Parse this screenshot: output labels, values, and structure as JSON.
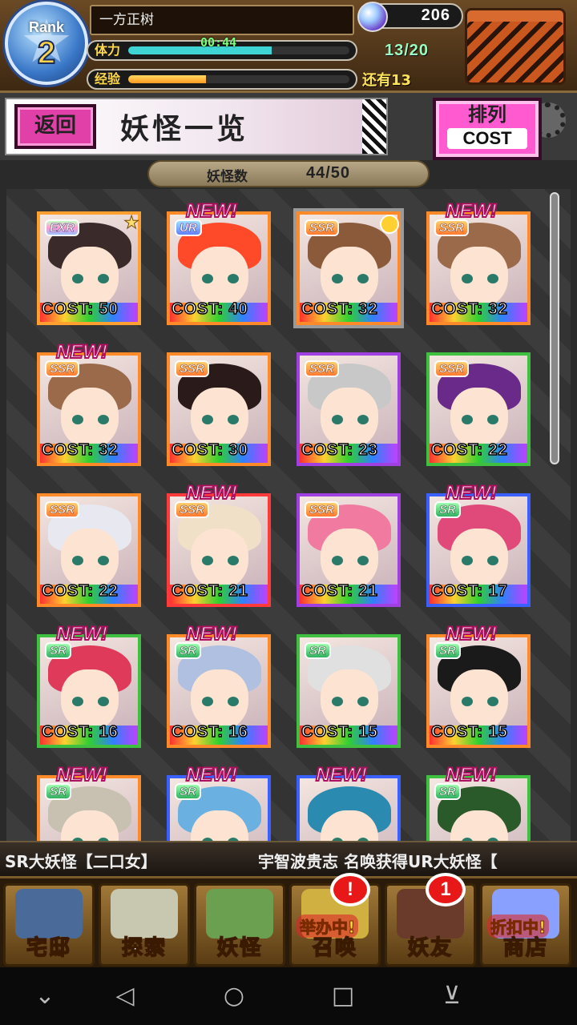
{
  "header": {
    "rank_label": "Rank",
    "rank_value": "2",
    "player_name": "一方正树",
    "stamina_label": "体力",
    "stamina_timer": "00:44",
    "stamina_count": "13/20",
    "stamina_fraction": 0.65,
    "exp_label": "经验",
    "exp_remaining": "还有13",
    "exp_fraction": 0.35,
    "gems": "206"
  },
  "title_bar": {
    "back_label": "返回",
    "page_title": "妖怪一览",
    "sort_line1": "排列",
    "sort_line2": "COST"
  },
  "count": {
    "label": "妖怪数",
    "value": "44/50"
  },
  "cards": [
    {
      "rarity": "EXR",
      "cost": "COST: 50",
      "new": false,
      "crown": false,
      "star": true,
      "border": "#ffa030",
      "hair": "#3a2a2a"
    },
    {
      "rarity": "UR",
      "cost": "COST: 40",
      "new": true,
      "crown": false,
      "star": false,
      "border": "#ff8a2a",
      "hair": "#ff4a2a"
    },
    {
      "rarity": "SSR",
      "cost": "COST: 32",
      "new": false,
      "crown": true,
      "star": false,
      "border": "#ff8a2a",
      "hair": "#8a5a3a"
    },
    {
      "rarity": "SSR",
      "cost": "COST: 32",
      "new": true,
      "crown": false,
      "star": false,
      "border": "#ff8a2a",
      "hair": "#9a6a4a"
    },
    {
      "rarity": "SSR",
      "cost": "COST: 32",
      "new": true,
      "crown": false,
      "star": false,
      "border": "#ff8a2a",
      "hair": "#9a6a4a"
    },
    {
      "rarity": "SSR",
      "cost": "COST: 30",
      "new": false,
      "crown": false,
      "star": false,
      "border": "#ff8a2a",
      "hair": "#2a1a1a"
    },
    {
      "rarity": "SSR",
      "cost": "COST: 23",
      "new": false,
      "crown": false,
      "star": false,
      "border": "#a040e0",
      "hair": "#c8c8c8"
    },
    {
      "rarity": "SSR",
      "cost": "COST: 22",
      "new": false,
      "crown": false,
      "star": false,
      "border": "#40c040",
      "hair": "#6a2a8a"
    },
    {
      "rarity": "SSR",
      "cost": "COST: 22",
      "new": false,
      "crown": false,
      "star": false,
      "border": "#ff8a2a",
      "hair": "#e8e8f0"
    },
    {
      "rarity": "SSR",
      "cost": "COST: 21",
      "new": true,
      "crown": false,
      "star": false,
      "border": "#ff3a3a",
      "hair": "#f0e0c8"
    },
    {
      "rarity": "SSR",
      "cost": "COST: 21",
      "new": false,
      "crown": false,
      "star": false,
      "border": "#a040e0",
      "hair": "#f07aa0"
    },
    {
      "rarity": "SR",
      "cost": "COST: 17",
      "new": true,
      "crown": false,
      "star": false,
      "border": "#3a60ff",
      "hair": "#e04a7a"
    },
    {
      "rarity": "SR",
      "cost": "COST: 16",
      "new": true,
      "crown": false,
      "star": false,
      "border": "#40c040",
      "hair": "#e03a5a"
    },
    {
      "rarity": "SR",
      "cost": "COST: 16",
      "new": true,
      "crown": false,
      "star": false,
      "border": "#ff8a2a",
      "hair": "#b0c0e0"
    },
    {
      "rarity": "SR",
      "cost": "COST: 15",
      "new": false,
      "crown": false,
      "star": false,
      "border": "#40c040",
      "hair": "#e0e0e0"
    },
    {
      "rarity": "SR",
      "cost": "COST: 15",
      "new": true,
      "crown": false,
      "star": false,
      "border": "#ff8a2a",
      "hair": "#1a1a1a"
    },
    {
      "rarity": "SR",
      "cost": "",
      "new": true,
      "crown": false,
      "star": false,
      "border": "#ff8a2a",
      "hair": "#c8c0b0"
    },
    {
      "rarity": "SR",
      "cost": "",
      "new": true,
      "crown": false,
      "star": false,
      "border": "#3a60ff",
      "hair": "#6ab0e0"
    },
    {
      "rarity": "",
      "cost": "",
      "new": true,
      "crown": false,
      "star": false,
      "border": "#3a60ff",
      "hair": "#2a8ab0"
    },
    {
      "rarity": "SR",
      "cost": "",
      "new": true,
      "crown": false,
      "star": false,
      "border": "#40c040",
      "hair": "#2a5a2a"
    }
  ],
  "new_label": "NEW!",
  "ticker": {
    "left": "SR大妖怪【二口女】",
    "right": "宇智波贵志 名唤获得UR大妖怪【"
  },
  "nav": [
    {
      "label": "宅邸",
      "icon": "house-icon",
      "color": "#4a6a9a",
      "badge": "",
      "ribbon": ""
    },
    {
      "label": "探索",
      "icon": "magnifier-icon",
      "color": "#c8c8b0",
      "badge": "",
      "ribbon": ""
    },
    {
      "label": "妖怪",
      "icon": "scroll-icon",
      "color": "#6aa050",
      "badge": "",
      "ribbon": ""
    },
    {
      "label": "召唤",
      "icon": "summon-star-icon",
      "color": "#d0b040",
      "badge": "!",
      "ribbon": "举办中!"
    },
    {
      "label": "妖友",
      "icon": "fox-girl-icon",
      "color": "#6a3a2a",
      "badge": "1",
      "ribbon": ""
    },
    {
      "label": "商店",
      "icon": "shop-orb-icon",
      "color": "#8aa0ff",
      "badge": "",
      "ribbon": "折扣中!"
    }
  ],
  "android_nav": {
    "back": "◁",
    "home": "○",
    "recent": "□",
    "menu": "⊻",
    "collapse": "⌄"
  }
}
